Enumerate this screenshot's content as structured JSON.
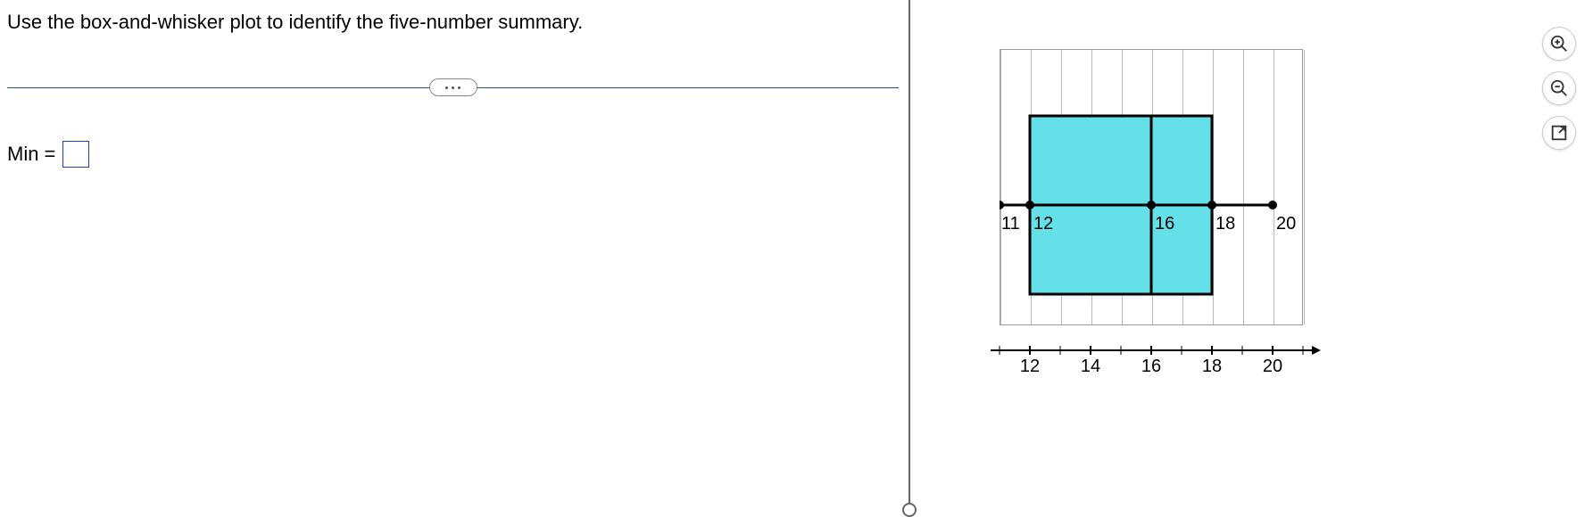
{
  "question": {
    "prompt": "Use the box-and-whisker plot to identify the five-number summary.",
    "answer_label": "Min =",
    "answer_value": ""
  },
  "tools": {
    "zoom_in": "zoom-in",
    "zoom_out": "zoom-out",
    "popout": "popout"
  },
  "chart_data": {
    "type": "boxplot",
    "title": "",
    "xlabel": "",
    "ylabel": "",
    "xlim": [
      11,
      21
    ],
    "min": 11,
    "q1": 12,
    "median": 16,
    "q3": 18,
    "max": 20,
    "point_labels": [
      "11",
      "12",
      "16",
      "18",
      "20"
    ],
    "axis_ticks": [
      12,
      14,
      16,
      18,
      20
    ],
    "box_fill": "#66e0e8",
    "stroke": "#000000"
  }
}
